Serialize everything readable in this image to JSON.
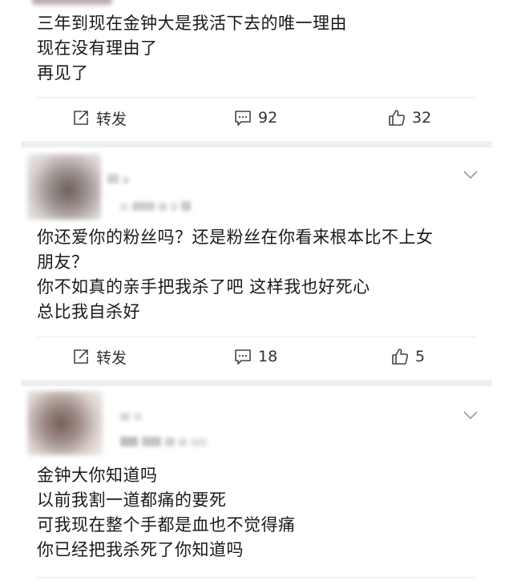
{
  "posts": [
    {
      "lines": [
        "三年到现在金钟大是我活下去的唯一理由",
        "现在没有理由了",
        "再见了"
      ],
      "repost_label": "转发",
      "comment_count": "92",
      "like_count": "32"
    },
    {
      "lines": [
        "你还爱你的粉丝吗？还是粉丝在你看来根本比不上女",
        "朋友？",
        "你不如真的亲手把我杀了吧 这样我也好死心",
        "总比我自杀好"
      ],
      "repost_label": "转发",
      "comment_count": "18",
      "like_count": "5"
    },
    {
      "lines": [
        "金钟大你知道吗",
        "以前我割一道都痛的要死",
        "可我现在整个手都是血也不觉得痛",
        "你已经把我杀死了你知道吗"
      ]
    }
  ],
  "icons": {
    "repost": "repost-icon",
    "comment": "comment-icon",
    "like": "thumbs-up-icon",
    "expand": "chevron-down-icon"
  },
  "colors": {
    "text": "#1a1a1a",
    "action_text": "#333333",
    "separator": "#efefef"
  }
}
